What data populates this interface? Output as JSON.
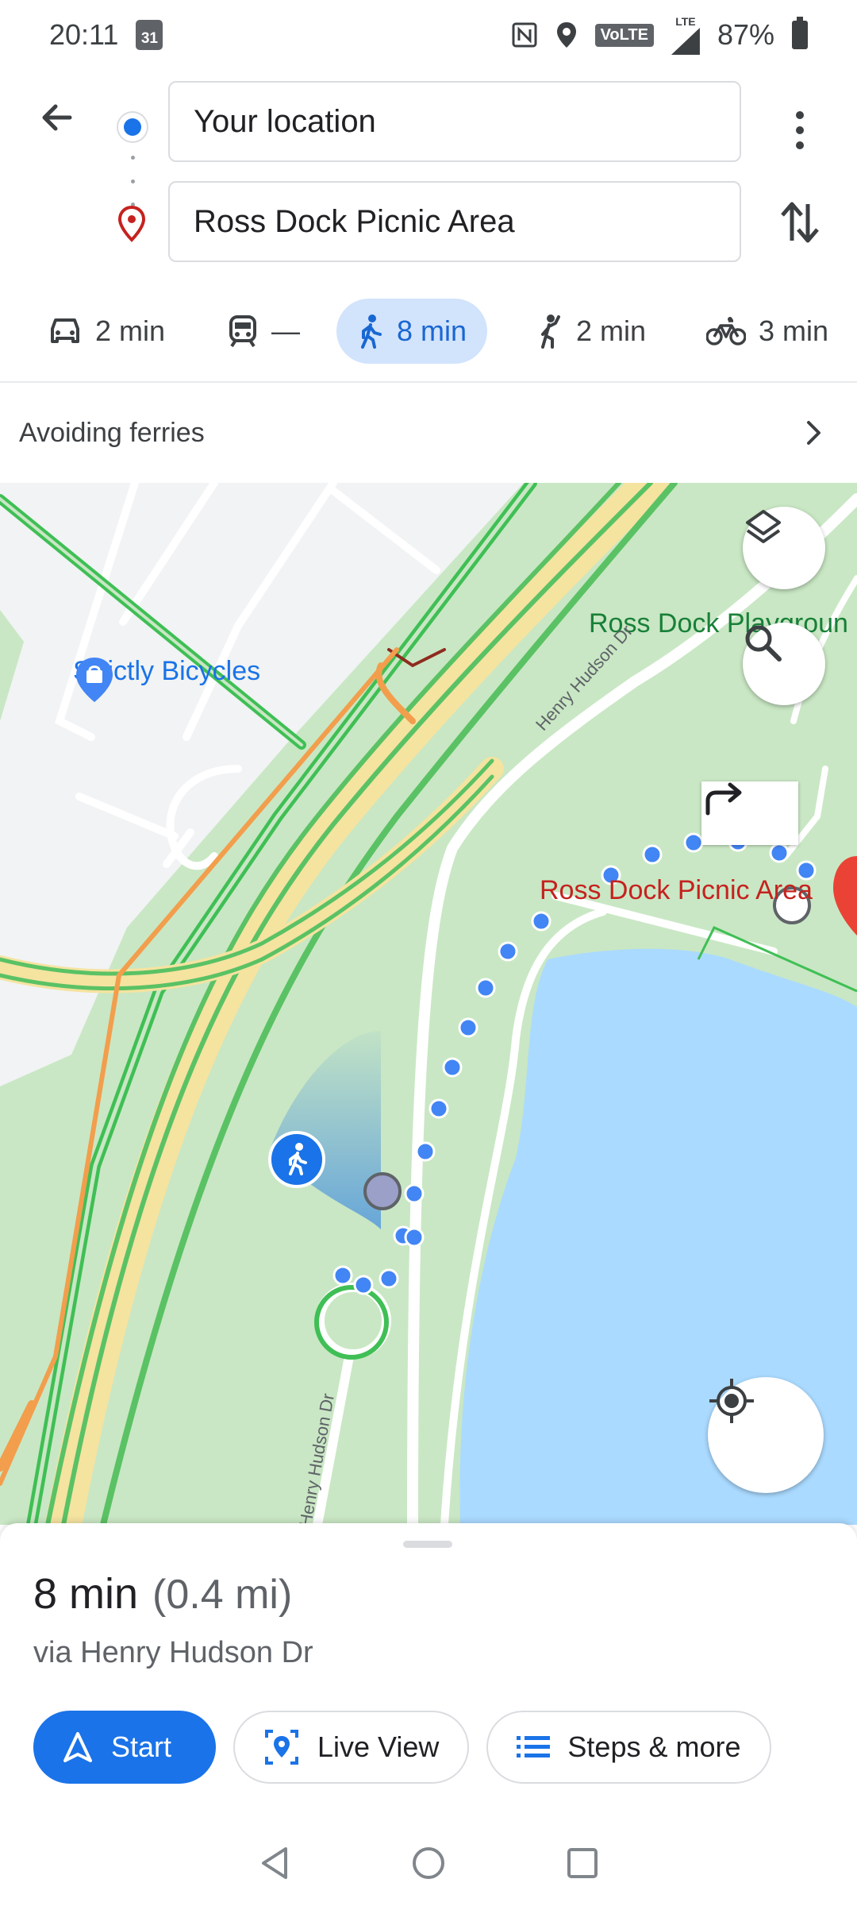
{
  "status": {
    "time": "20:11",
    "calendar_day": "31",
    "volte": "VoLTE",
    "lte": "LTE",
    "battery": "87%"
  },
  "route": {
    "origin": "Your location",
    "destination": "Ross Dock Picnic Area"
  },
  "modes": [
    {
      "name": "car",
      "value": "2 min"
    },
    {
      "name": "transit",
      "value": "—"
    },
    {
      "name": "walk",
      "value": "8 min",
      "selected": true
    },
    {
      "name": "rideshare",
      "value": "2 min"
    },
    {
      "name": "bike",
      "value": "3 min"
    }
  ],
  "avoid_text": "Avoiding ferries",
  "map": {
    "labels": {
      "playground": "Ross Dock Playgroun",
      "bicycles": "Strictly Bicycles",
      "picnic": "Ross Dock Picnic Area",
      "road1": "Henry Hudson Dr",
      "road2": "Henry Hudson Dr"
    }
  },
  "summary": {
    "duration": "8 min",
    "distance": "(0.4 mi)",
    "via": "via Henry Hudson Dr"
  },
  "actions": {
    "start": "Start",
    "live_view": "Live View",
    "steps": "Steps & more"
  },
  "colors": {
    "accent": "#1a73e8",
    "selected_bg": "#d2e3fc",
    "park": "#c9e7c4",
    "water": "#aadaff",
    "pin": "#ea4335"
  }
}
